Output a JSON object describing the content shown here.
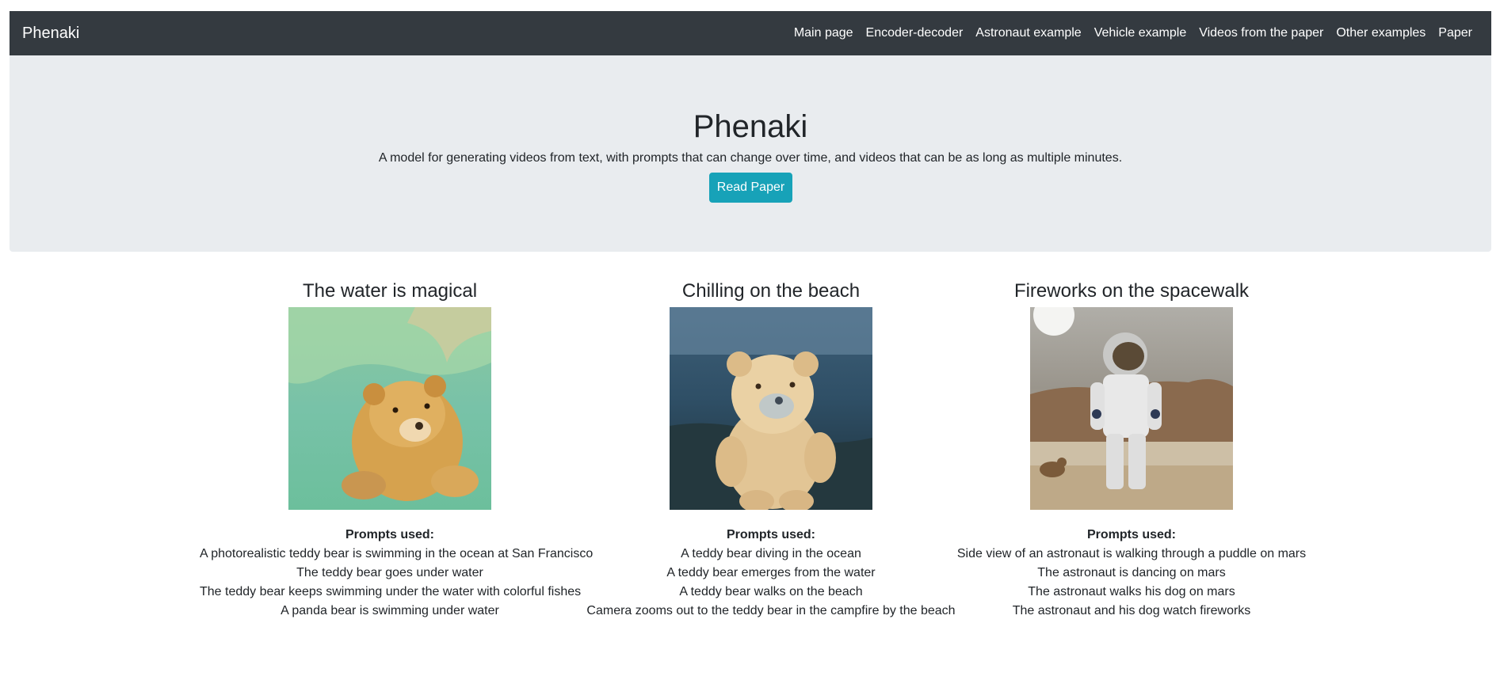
{
  "navbar": {
    "brand": "Phenaki",
    "links": [
      {
        "label": "Main page"
      },
      {
        "label": "Encoder-decoder"
      },
      {
        "label": "Astronaut example"
      },
      {
        "label": "Vehicle example"
      },
      {
        "label": "Videos from the paper"
      },
      {
        "label": "Other examples"
      },
      {
        "label": "Paper"
      }
    ]
  },
  "hero": {
    "title": "Phenaki",
    "subtitle": "A model for generating videos from text, with prompts that can change over time, and videos that can be as long as multiple minutes.",
    "button_label": "Read Paper"
  },
  "cards": [
    {
      "title": "The water is magical",
      "prompts_label": "Prompts used:",
      "prompts": [
        "A photorealistic teddy bear is swimming in the ocean at San Francisco",
        "The teddy bear goes under water",
        "The teddy bear keeps swimming under the water with colorful fishes",
        "A panda bear is swimming under water"
      ]
    },
    {
      "title": "Chilling on the beach",
      "prompts_label": "Prompts used:",
      "prompts": [
        "A teddy bear diving in the ocean",
        "A teddy bear emerges from the water",
        "A teddy bear walks on the beach",
        "Camera zooms out to the teddy bear in the campfire by the beach"
      ]
    },
    {
      "title": "Fireworks on the spacewalk",
      "prompts_label": "Prompts used:",
      "prompts": [
        "Side view of an astronaut is walking through a puddle on mars",
        "The astronaut is dancing on mars",
        "The astronaut walks his dog on mars",
        "The astronaut and his dog watch fireworks"
      ]
    }
  ],
  "colors": {
    "navbar_bg": "#343a40",
    "jumbotron_bg": "#e9ecef",
    "button_bg": "#17a2b8"
  }
}
